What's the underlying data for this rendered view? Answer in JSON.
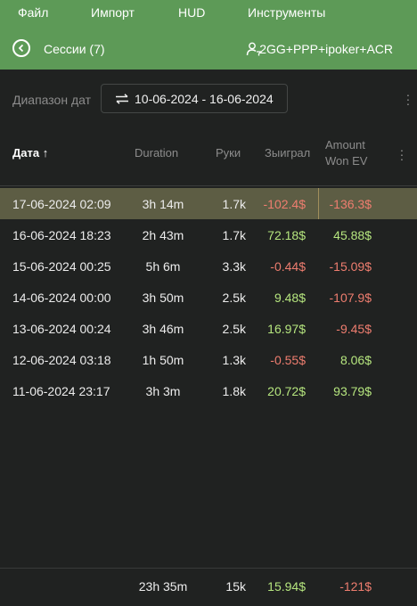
{
  "menu": {
    "items": [
      "Файл",
      "Импорт",
      "HUD",
      "Инструменты"
    ]
  },
  "header": {
    "title": "Сессии (7)",
    "filter": "2GG+PPP+ipoker+ACR"
  },
  "date_range": {
    "label": "Диапазон дат",
    "value": "10-06-2024 - 16-06-2024"
  },
  "table": {
    "columns": {
      "date": "Дата ↑",
      "duration": "Duration",
      "hands": "Руки",
      "won": "Зыиграл",
      "won_ev_line1": "Amount",
      "won_ev_line2": "Won EV"
    },
    "rows": [
      {
        "date": "17-06-2024 02:09",
        "duration": "3h 14m",
        "hands": "1.7k",
        "won": "-102.4$",
        "won_ev": "-136.3$"
      },
      {
        "date": "16-06-2024 18:23",
        "duration": "2h 43m",
        "hands": "1.7k",
        "won": "72.18$",
        "won_ev": "45.88$"
      },
      {
        "date": "15-06-2024 00:25",
        "duration": "5h 6m",
        "hands": "3.3k",
        "won": "-0.44$",
        "won_ev": "-15.09$"
      },
      {
        "date": "14-06-2024 00:00",
        "duration": "3h 50m",
        "hands": "2.5k",
        "won": "9.48$",
        "won_ev": "-107.9$"
      },
      {
        "date": "13-06-2024 00:24",
        "duration": "3h 46m",
        "hands": "2.5k",
        "won": "16.97$",
        "won_ev": "-9.45$"
      },
      {
        "date": "12-06-2024 03:18",
        "duration": "1h 50m",
        "hands": "1.3k",
        "won": "-0.55$",
        "won_ev": "8.06$"
      },
      {
        "date": "11-06-2024 23:17",
        "duration": "3h 3m",
        "hands": "1.8k",
        "won": "20.72$",
        "won_ev": "93.79$"
      }
    ],
    "totals": {
      "duration": "23h 35m",
      "hands": "15k",
      "won": "15.94$",
      "won_ev": "-121$"
    }
  },
  "colors": {
    "accent": "#5d9a57",
    "positive": "#b5e57e",
    "negative": "#ee7d6f",
    "selected_row": "#5d5d44"
  }
}
